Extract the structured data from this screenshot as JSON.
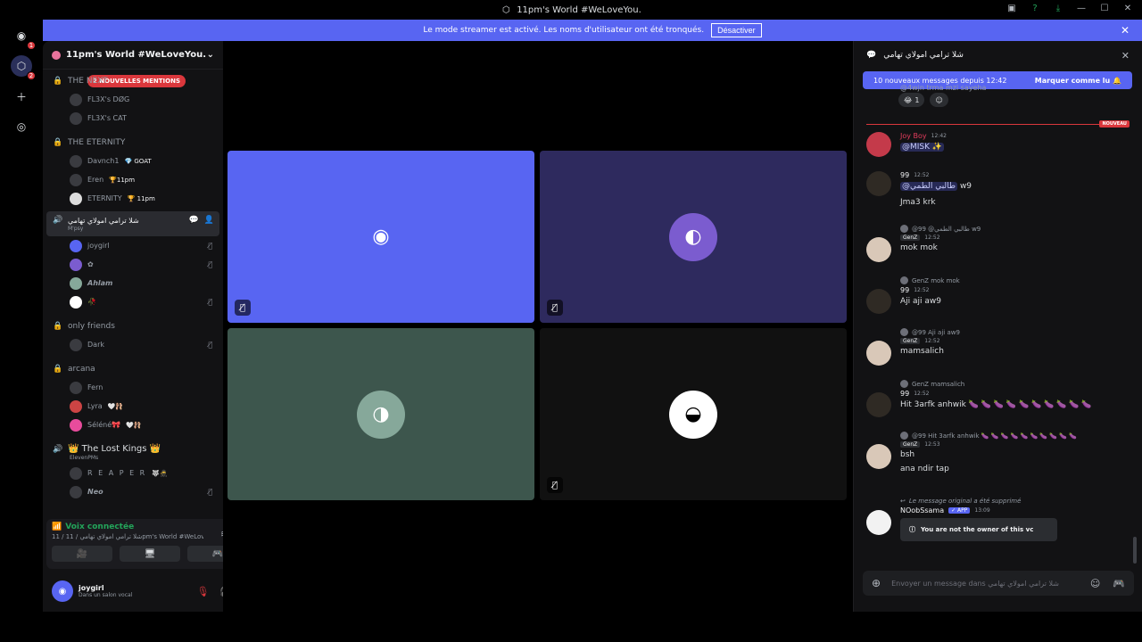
{
  "window": {
    "title": "11pm's World #WeLoveYou."
  },
  "banner": {
    "text": "Le mode streamer est activé. Les noms d'utilisateur ont été tronqués.",
    "button": "Désactiver"
  },
  "rail": {
    "badges": [
      "1",
      "2"
    ]
  },
  "sidebar": {
    "server_name": "11pm's World #WeLoveYou.",
    "mention_pill": "2 NOUVELLES MENTIONS",
    "channels": [
      {
        "name": "THE NEXT",
        "members": [
          {
            "name": "FL3X's DØG"
          },
          {
            "name": "FL3X's CAT"
          }
        ]
      },
      {
        "name": "THE ETERNITY",
        "members": [
          {
            "name": "Davnch1",
            "tag": "💎 GOAT"
          },
          {
            "name": "Eren",
            "tag": "🏆11pm"
          },
          {
            "name": "ETERNITY",
            "tag": "🏆 11pm"
          }
        ]
      },
      {
        "name": "شلا ترامي امولاي تهامي",
        "sub": "M'psy",
        "active": true,
        "members": [
          {
            "name": "joygirl"
          },
          {
            "name": "✿"
          },
          {
            "name": "Ahlam"
          },
          {
            "name": "🥀"
          }
        ]
      },
      {
        "name": "only friends",
        "members": [
          {
            "name": "Dark"
          }
        ]
      },
      {
        "name": "arcana",
        "members": [
          {
            "name": "Fern"
          },
          {
            "name": "Lyra",
            "tag": "🤍🩰"
          },
          {
            "name": "Séléné🎀",
            "tag": "🤍🩰"
          }
        ]
      },
      {
        "name": "👑 The Lost Kings 👑",
        "sub": "ElevenPMs",
        "members": [
          {
            "name": "R E A P E R",
            "tag": "🐺🥷"
          },
          {
            "name": "Neo"
          }
        ]
      }
    ]
  },
  "voice": {
    "status": "Voix connectée",
    "sub": "11 / شلا ترامي امولاي تهامي / 11pm's World #WeLov..."
  },
  "user": {
    "name": "joygirl",
    "status": "Dans un salon vocal"
  },
  "stage": {
    "tiles": [
      {
        "color": "#5865f2",
        "avatar_bg": "#5865f2",
        "icon": "discord-logo",
        "muted": true
      },
      {
        "color": "#2e2a5e",
        "avatar_bg": "#7b5ccf",
        "icon": "avatar",
        "muted": true
      },
      {
        "color": "#3d564d",
        "avatar_bg": "#86a89a",
        "icon": "avatar",
        "muted": false
      },
      {
        "color": "#111111",
        "avatar_bg": "#ffffff",
        "icon": "avatar",
        "muted": true
      }
    ]
  },
  "chat": {
    "channel_name": "شلا ترامي امولاي تهامي",
    "new_bar": {
      "text": "10 nouveaux messages depuis 12:42",
      "action": "Marquer comme lu"
    },
    "partial_text": "@4wjn trma mzi sayeha",
    "reaction_count": "1",
    "new_label": "NOUVEAU",
    "messages": [
      {
        "author": "Joy Boy",
        "time": "12:42",
        "text": "@MISK ✨"
      },
      {
        "author": "99",
        "time": "12:52",
        "mention": "@طالبي الطمي",
        "text": "w9",
        "text2": "Jma3 krk"
      },
      {
        "reply": "@99 @طالبي الطمي w9",
        "badge": "GenZ",
        "time": "12:52",
        "text": "mok mok"
      },
      {
        "reply": "GenZ mok mok",
        "author": "99",
        "time": "12:52",
        "text": "Aji aji aw9"
      },
      {
        "reply": "@99 Aji aji aw9",
        "badge": "GenZ",
        "time": "12:52",
        "text": "mamsalich"
      },
      {
        "reply": "GenZ mamsalich",
        "author": "99",
        "time": "12:52",
        "text": "Hit 3arfk anhwik 🍆 🍆 🍆 🍆 🍆 🍆 🍆 🍆 🍆 🍆"
      },
      {
        "reply": "@99 Hit 3arfk anhwik 🍆 🍆 🍆 🍆 🍆 🍆 🍆 🍆 🍆 🍆",
        "badge": "GenZ",
        "time": "12:53",
        "text": "bsh",
        "text2": "ana ndir tap"
      },
      {
        "reply": "Le message original a été supprimé",
        "author": "NOobSsama",
        "app": "✓ APP",
        "time": "13:09",
        "embed": "You are not the owner of this vc"
      }
    ],
    "composer_placeholder": "Envoyer un message dans شلا ترامي امولاي تهامي"
  }
}
